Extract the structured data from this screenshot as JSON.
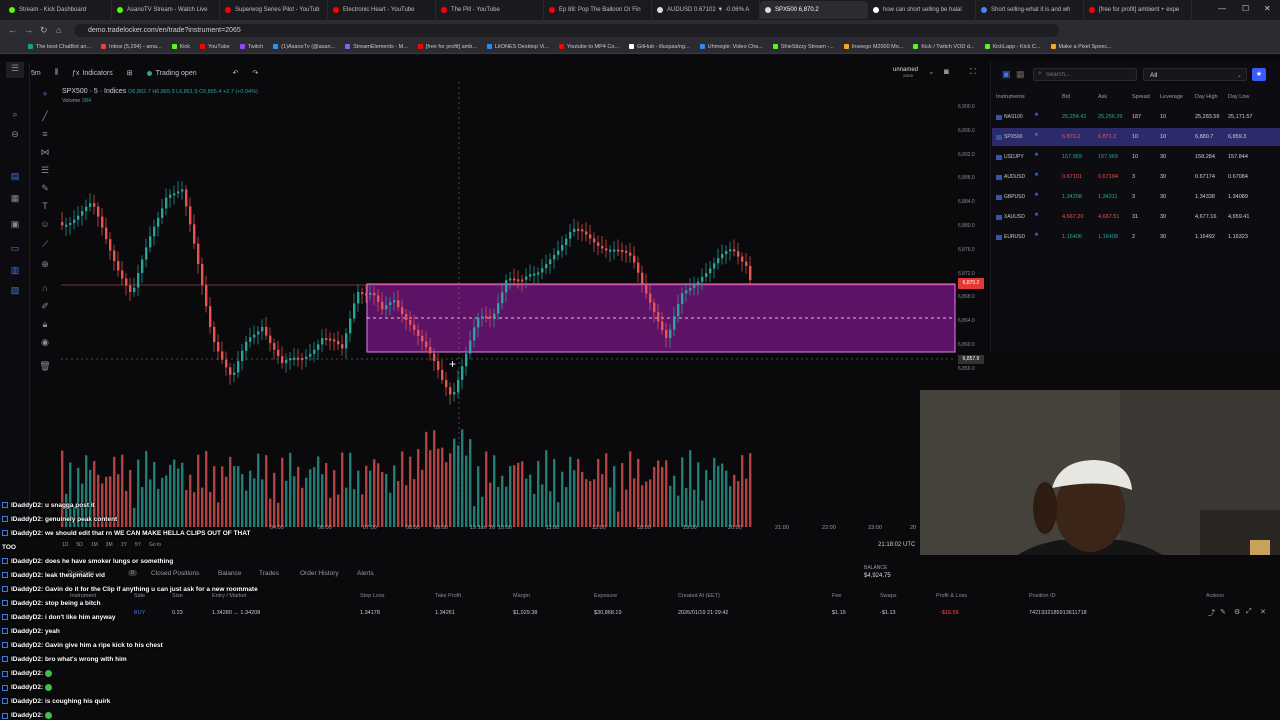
{
  "browser": {
    "tabs": [
      {
        "label": "Stream - Kick Dashboard",
        "color": "#53fc18"
      },
      {
        "label": "AsanoTV Stream - Watch Live",
        "color": "#53fc18"
      },
      {
        "label": "Superwog Series Pilot - YouTub",
        "color": "#ff0000"
      },
      {
        "label": "Electronic Heart - YouTube",
        "color": "#ff0000"
      },
      {
        "label": "The Pill - YouTube",
        "color": "#ff0000"
      },
      {
        "label": "Ep 88: Pop The Balloon Or Fin",
        "color": "#ff0000"
      },
      {
        "label": "AUDUSD 0.67102 ▼ -0.06% A",
        "color": "#dddddd"
      },
      {
        "label": "SPX500 6,870.2",
        "color": "#dddddd",
        "active": true
      },
      {
        "label": "how can short selling be halal",
        "color": "#ffffff"
      },
      {
        "label": "Short selling-what it is and wh",
        "color": "#4285f4"
      },
      {
        "label": "[free for profit] ambient + expe",
        "color": "#ff0000"
      }
    ],
    "url": "demo.tradelocker.com/en/trade?instrument=2065",
    "bookmarks": [
      {
        "label": "The best ChatBot an...",
        "color": "#10a37f"
      },
      {
        "label": "Inbox (5,294) - ama...",
        "color": "#ea4335"
      },
      {
        "label": "Kick",
        "color": "#53fc18"
      },
      {
        "label": "YouTube",
        "color": "#ff0000"
      },
      {
        "label": "Twitch",
        "color": "#9146ff"
      },
      {
        "label": "(1)AsanoTv (@asan...",
        "color": "#1d9bf0"
      },
      {
        "label": "StreamElements - M...",
        "color": "#7b68ee"
      },
      {
        "label": "[free for profit] amb...",
        "color": "#ff0000"
      },
      {
        "label": "LitONES Desktop Vi...",
        "color": "#1e90ff"
      },
      {
        "label": "Youtube to MP4 Co...",
        "color": "#ff0000"
      },
      {
        "label": "GitHub - illuspas/ng...",
        "color": "#ffffff"
      },
      {
        "label": "Uhmegle: Video Cha...",
        "color": "#3b82f6"
      },
      {
        "label": "ShieStizzy Stream -...",
        "color": "#53fc18"
      },
      {
        "label": "Inseego M2000 Mo...",
        "color": "#f5a623"
      },
      {
        "label": "Kick / Twitch VOD d...",
        "color": "#53fc18"
      },
      {
        "label": "KickLapp - Kick C...",
        "color": "#53fc18"
      },
      {
        "label": "Make a Pixel Speec...",
        "color": "#f5a623"
      }
    ]
  },
  "toolbar": {
    "timeframe": "5m",
    "indicators": "Indicators",
    "trading": "Trading open",
    "layout_name": "unnamed",
    "layout_sub": "Save"
  },
  "chart": {
    "symbol": "SPX500 · 5 · Indices",
    "ohlc": "O6,862.7  H6,865.9  L6,861.9  C6,865.4  +2.7 (+0.04%)",
    "volume_label": "Volume",
    "volume_value": "284",
    "price_ticks": [
      "6,900.0",
      "6,896.0",
      "6,892.0",
      "6,888.0",
      "6,884.0",
      "6,880.0",
      "6,876.0",
      "6,872.0",
      "6,868.0",
      "6,864.0",
      "6,860.0",
      "6,856.0"
    ],
    "price_marker": "6,870.2",
    "crosshair_price": "6,857.9",
    "time_ticks": [
      "04:00",
      "06:00",
      "07:00",
      "08:00",
      "09:00",
      "19 Jan '26",
      "10:00",
      "11:00",
      "12:00",
      "18:00",
      "19:00",
      "20:00",
      "21:00",
      "22:00",
      "23:00",
      "20",
      "01:00"
    ],
    "clock": "21:18:02 UTC",
    "range_buttons": [
      "1D",
      "5D",
      "1M",
      "3M",
      "1Y",
      "5Y",
      "Go to"
    ]
  },
  "instruments": {
    "search_placeholder": "Search...",
    "filter": "All",
    "headers": [
      "Instruments",
      "Bid",
      "Ask",
      "Spread",
      "Leverage",
      "Day High",
      "Day Low"
    ],
    "rows": [
      {
        "name": "NAS100",
        "bid": "25,254.42",
        "ask": "25,256.29",
        "spread": "187",
        "lev": "10",
        "high": "25,283.59",
        "low": "25,171.57",
        "dir": "up"
      },
      {
        "name": "SPX500",
        "bid": "6,870.2",
        "ask": "6,871.2",
        "spread": "10",
        "lev": "10",
        "high": "6,880.7",
        "low": "6,859.3",
        "dir": "down",
        "selected": true
      },
      {
        "name": "USDJPY",
        "bid": "157.959",
        "ask": "157.969",
        "spread": "10",
        "lev": "30",
        "high": "158.284",
        "low": "157.844",
        "dir": "up"
      },
      {
        "name": "AUDUSD",
        "bid": "0.67101",
        "ask": "0.67104",
        "spread": "3",
        "lev": "30",
        "high": "0.67174",
        "low": "0.67084",
        "dir": "down"
      },
      {
        "name": "GBPUSD",
        "bid": "1.34208",
        "ask": "1.34211",
        "spread": "3",
        "lev": "30",
        "high": "1.34338",
        "low": "1.34089",
        "dir": "up"
      },
      {
        "name": "XAUUSD",
        "bid": "4,667.20",
        "ask": "4,667.51",
        "spread": "31",
        "lev": "30",
        "high": "4,677.16",
        "low": "4,659.41",
        "dir": "down"
      },
      {
        "name": "EURUSD",
        "bid": "1.16406",
        "ask": "1.16408",
        "spread": "2",
        "lev": "30",
        "high": "1.16492",
        "low": "1.16323",
        "dir": "up"
      }
    ]
  },
  "positions": {
    "tabs": [
      "Positions",
      "Closed Positions",
      "Balance",
      "Trades",
      "Order History",
      "Alerts"
    ],
    "positions_count": "0",
    "balance_label": "BALANCE",
    "balance_value": "$4,924.75",
    "columns": [
      "Instrument",
      "Side",
      "Size",
      "Entry / Market",
      "Stop Loss",
      "Take Profit",
      "Margin",
      "Exposure",
      "Created At (EET)",
      "Fee",
      "Swaps",
      "Profit & Loss",
      "Position ID",
      "Actions"
    ],
    "row": {
      "side": "BUY",
      "size": "0.23",
      "entry": "1.34280 → 1.34208",
      "sl": "1.34178",
      "tp": "1.34261",
      "margin": "$1,029.38",
      "exposure": "$30,868.19",
      "created": "2026/01/19 21:29:42",
      "fee": "$1.15",
      "swaps": "-$1.13",
      "pnl": "-$16.56",
      "id": "7421932185913611718"
    }
  },
  "chat": [
    {
      "user": "lDaddyD2",
      "text": "u snagga post it"
    },
    {
      "user": "lDaddyD2",
      "text": "genuinely peak content"
    },
    {
      "user": "lDaddyD2",
      "text": "we should edit that rn WE CAN MAKE HELLA CLIPS OUT OF THAT"
    },
    {
      "user": "",
      "text": "TOO"
    },
    {
      "user": "lDaddyD2",
      "text": "does he have smoker lungs or something"
    },
    {
      "user": "lDaddyD2",
      "text": "leak thespmatic vid"
    },
    {
      "user": "lDaddyD2",
      "text": "Gavin do it for the Clip if anything u can just ask for a new roommate"
    },
    {
      "user": "lDaddyD2",
      "text": "stop being a bitch"
    },
    {
      "user": "lDaddyD2",
      "text": "i don't like him anyway"
    },
    {
      "user": "lDaddyD2",
      "text": "yeah"
    },
    {
      "user": "lDaddyD2",
      "text": "Gavin give him a ripe kick to his chest"
    },
    {
      "user": "lDaddyD2",
      "text": "bro what's wrong with him"
    },
    {
      "user": "lDaddyD2",
      "text": "",
      "emote": true
    },
    {
      "user": "lDaddyD2",
      "text": "",
      "emote": true
    },
    {
      "user": "lDaddyD2",
      "text": "is coughing his quirk"
    },
    {
      "user": "lDaddyD2",
      "text": "",
      "emote": true
    }
  ],
  "colors": {
    "up": "#26a69a",
    "down": "#ef5350",
    "zone": "#c026d3",
    "accent": "#3b5bff"
  }
}
